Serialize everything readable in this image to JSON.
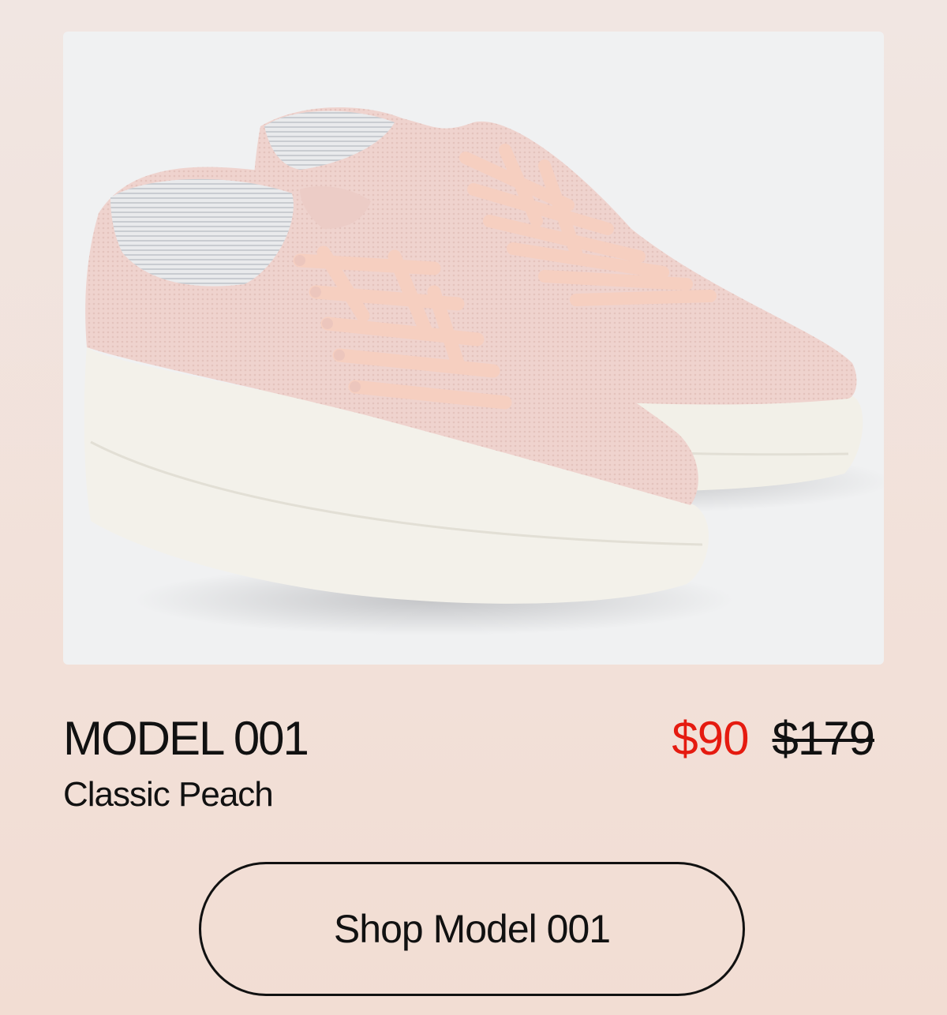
{
  "product": {
    "name": "MODEL 001",
    "variant": "Classic Peach",
    "price_sale": "$90",
    "price_original": "$179",
    "image_alt": "Pair of peach knit sneakers with white soles",
    "image_icon": "sneaker-pair-image",
    "colors": {
      "upper": "#efd2cd",
      "sole": "#f3f1ea",
      "lace": "#f6cfc0",
      "background": "#f0f1f2",
      "sale_price": "#e51b10"
    }
  },
  "cta": {
    "label": "Shop Model 001"
  }
}
